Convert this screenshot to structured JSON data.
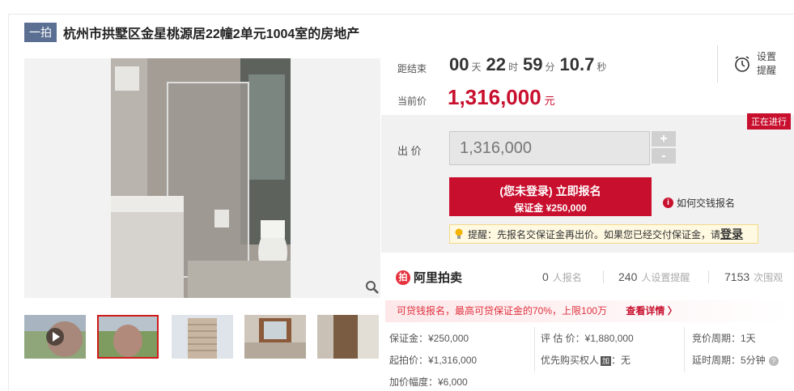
{
  "header": {
    "badge": "一拍",
    "title": "杭州市拱墅区金星桃源居22幢2单元1004室的房地产"
  },
  "countdown": {
    "label": "距结束",
    "days": "00",
    "days_unit": "天",
    "hours": "22",
    "hours_unit": "时",
    "minutes": "59",
    "minutes_unit": "分",
    "seconds": "10.7",
    "seconds_unit": "秒"
  },
  "current_price": {
    "label": "当前价",
    "value": "1,316,000",
    "unit": "元"
  },
  "reminder": {
    "line1": "设置",
    "line2": "提醒"
  },
  "bid": {
    "status": "正在进行",
    "label": "出 价",
    "input_value": "1,316,000",
    "plus": "+",
    "minus": "-",
    "register_line1": "(您未登录) 立即报名",
    "register_line2": "保证金 ¥250,000",
    "howto": "如何交钱报名",
    "notice_text": "提醒：先报名交保证金再出价。如果您已经交付保证金，请",
    "notice_login": "登录"
  },
  "stats": {
    "logo": "阿里拍卖",
    "signups": "0",
    "signups_label": "人报名",
    "reminders": "240",
    "reminders_label": "人设置提醒",
    "views": "7153",
    "views_label": "次围观"
  },
  "promo": {
    "text": "可贷钱报名，最高可贷保证金的70%，上限100万",
    "detail": "查看详情 〉"
  },
  "details": {
    "deposit": "保证金：¥250,000",
    "start_price": "起拍价：¥1,316,000",
    "increment": "加价幅度：¥6,000",
    "appraisal": "评 估 价：¥1,880,000",
    "priority": "优先购买权人",
    "priority_tag": "加",
    "priority_value": "：无",
    "bid_period": "竞价周期：1天",
    "delay_period": "延时周期：5分钟"
  }
}
